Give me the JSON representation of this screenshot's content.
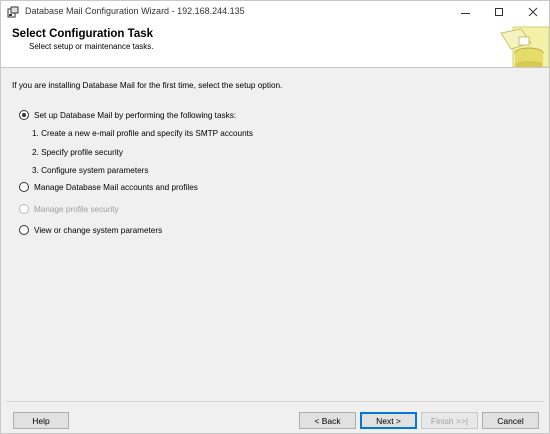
{
  "window": {
    "title": "Database Mail Configuration Wizard - 192.168.244.135"
  },
  "header": {
    "title": "Select Configuration Task",
    "subtitle": "Select setup or maintenance tasks."
  },
  "content": {
    "instruction": "If you are installing Database Mail for the first time, select the setup option.",
    "options": [
      {
        "label": "Set up Database Mail by performing the following tasks:",
        "checked": true,
        "disabled": false
      },
      {
        "label": "Manage Database Mail accounts and profiles",
        "checked": false,
        "disabled": false
      },
      {
        "label": "Manage profile security",
        "checked": false,
        "disabled": true
      },
      {
        "label": "View or change system parameters",
        "checked": false,
        "disabled": false
      }
    ],
    "steps": [
      "1. Create a new e-mail profile and specify its SMTP accounts",
      "2. Specify profile security",
      "3. Configure system parameters"
    ]
  },
  "footer": {
    "help_label": "Help",
    "back_label": "< Back",
    "next_label": "Next >",
    "finish_label": "Finish >>|",
    "cancel_label": "Cancel"
  },
  "colors": {
    "accent": "#0078d7",
    "disabled_text": "#a0a0a0"
  }
}
